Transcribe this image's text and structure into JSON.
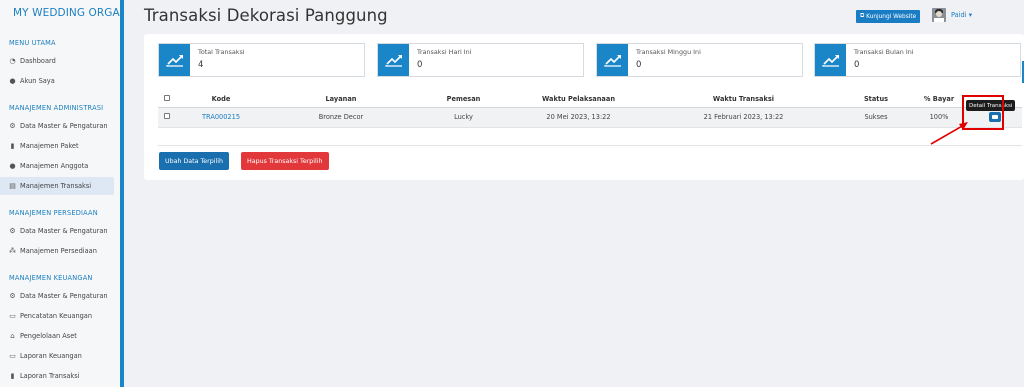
{
  "sidebar": {
    "brand": "MY WEDDING ORGAN",
    "sections": [
      {
        "title": "MENU UTAMA",
        "items": [
          {
            "icon": "dashboard-icon",
            "label": "Dashboard"
          },
          {
            "icon": "user-icon",
            "label": "Akun Saya"
          }
        ]
      },
      {
        "title": "MANAJEMEN ADMINISTRASI",
        "items": [
          {
            "icon": "gears-icon",
            "label": "Data Master & Pengaturan"
          },
          {
            "icon": "book-icon",
            "label": "Manajemen Paket"
          },
          {
            "icon": "users-icon",
            "label": "Manajemen Anggota"
          },
          {
            "icon": "cart-icon",
            "label": "Manajemen Transaksi",
            "active": true
          }
        ]
      },
      {
        "title": "MANAJEMEN PERSEDIAAN",
        "items": [
          {
            "icon": "gears-icon",
            "label": "Data Master & Pengaturan"
          },
          {
            "icon": "cubes-icon",
            "label": "Manajemen Persediaan"
          }
        ]
      },
      {
        "title": "MANAJEMEN KEUANGAN",
        "items": [
          {
            "icon": "gears-icon",
            "label": "Data Master & Pengaturan"
          },
          {
            "icon": "money-icon",
            "label": "Pencatatan Keuangan"
          },
          {
            "icon": "drive-icon",
            "label": "Pengelolaan Aset"
          },
          {
            "icon": "money-icon",
            "label": "Laporan Keuangan"
          },
          {
            "icon": "book-icon",
            "label": "Laporan Transaksi"
          }
        ]
      }
    ]
  },
  "header": {
    "title": "Transaksi Dekorasi Panggung",
    "visit_button": "Kunjungi Website",
    "username": "Paidi"
  },
  "stats": [
    {
      "label": "Total Transaksi",
      "value": "4"
    },
    {
      "label": "Transaksi Hari Ini",
      "value": "0"
    },
    {
      "label": "Transaksi Minggu Ini",
      "value": "0"
    },
    {
      "label": "Transaksi Bulan Ini",
      "value": "0"
    }
  ],
  "table": {
    "headers": [
      "Kode",
      "Layanan",
      "Pemesan",
      "Waktu Pelaksanaan",
      "Waktu Transaksi",
      "Status",
      "% Bayar"
    ],
    "rows": [
      {
        "kode": "TRA000215",
        "layanan": "Bronze Decor",
        "pemesan": "Lucky",
        "waktu_pelaksanaan": "20 Mei 2023, 13:22",
        "waktu_transaksi": "21 Februari 2023, 13:22",
        "status": "Sukses",
        "bayar": "100%"
      }
    ]
  },
  "actions": {
    "update_label": "Ubah Data Terpilih",
    "delete_label": "Hapus Transaksi Terpilih"
  },
  "tooltip": "Detail Transaksi",
  "colors": {
    "primary": "#1a86c8",
    "danger": "#e3383b",
    "annotation": "#e10000"
  }
}
